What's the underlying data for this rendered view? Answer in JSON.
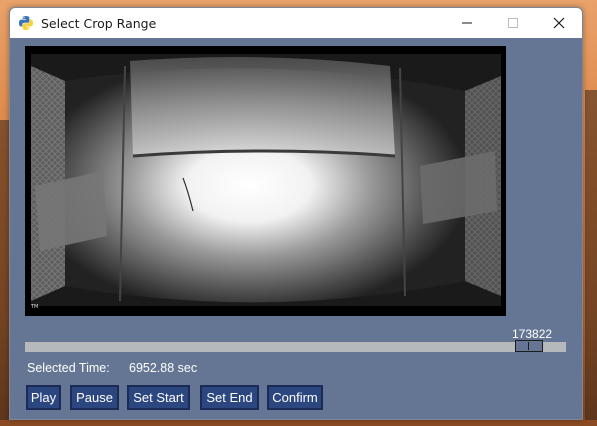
{
  "window": {
    "title": "Select Crop Range"
  },
  "slider": {
    "value_label": "173822",
    "position_fraction": 0.955
  },
  "selected_time": {
    "label": "Selected Time:",
    "value": "6952.88 sec"
  },
  "buttons": {
    "play": "Play",
    "pause": "Pause",
    "set_start": "Set Start",
    "set_end": "Set End",
    "confirm": "Confirm"
  },
  "video": {
    "corner_mark": "TM"
  },
  "colors": {
    "window_bg": "#647693",
    "button_bg": "#2c4780",
    "track": "#b5b9bc"
  }
}
